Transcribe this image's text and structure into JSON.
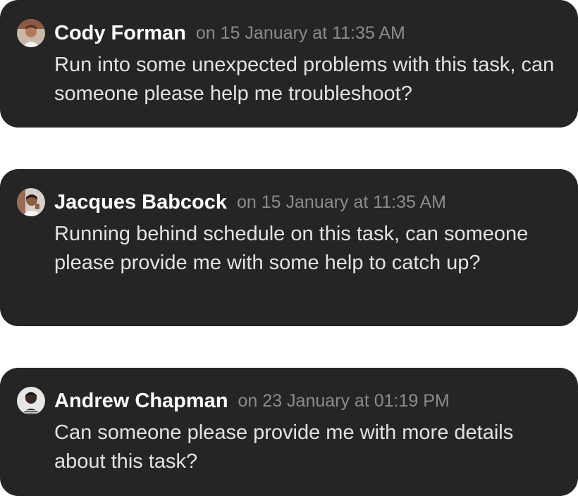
{
  "comments": [
    {
      "author": "Cody Forman",
      "timestamp": "on 15 January at 11:35 AM",
      "text": "Run into some unexpected problems with this task, can someone please help me troubleshoot?",
      "avatar_icon": "user-avatar-icon"
    },
    {
      "author": "Jacques Babcock",
      "timestamp": "on 15 January at 11:35 AM",
      "text": "Running behind schedule on this task, can someone please provide me with some help to catch up?",
      "avatar_icon": "user-avatar-icon"
    },
    {
      "author": "Andrew Chapman",
      "timestamp": "on 23 January at 01:19 PM",
      "text": "Can someone please provide me with more details about this task?",
      "avatar_icon": "user-avatar-icon"
    }
  ],
  "colors": {
    "card_background": "#252525",
    "author_text": "#ffffff",
    "timestamp_text": "#8b8b8b",
    "body_text": "#e2e2e2"
  }
}
